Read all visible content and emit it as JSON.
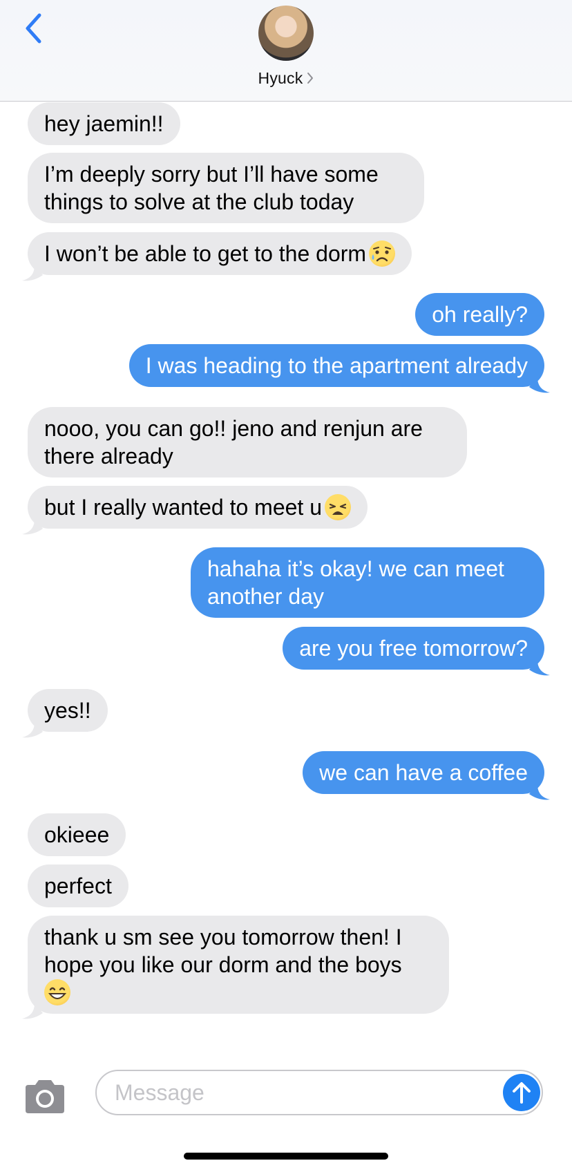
{
  "header": {
    "contact_name": "Hyuck",
    "avatar_icon": "contact-avatar-photo",
    "back_icon": "chevron-left-icon",
    "accent_color": "#2f7cf6"
  },
  "messages": [
    {
      "dir": "in",
      "text": "hey jaemin!!"
    },
    {
      "dir": "in",
      "text": "I’m deeply sorry but I’ll have some things to solve at the club today"
    },
    {
      "dir": "in",
      "text": "I won’t be able to get to the dorm",
      "emoji": "sad-relieved-face-emoji"
    },
    {
      "dir": "out",
      "text": "oh really?"
    },
    {
      "dir": "out",
      "text": "I was heading to the apartment already"
    },
    {
      "dir": "in",
      "text": "nooo, you can go!! jeno and renjun are there already"
    },
    {
      "dir": "in",
      "text": "but I really wanted to meet u",
      "emoji": "weary-face-emoji"
    },
    {
      "dir": "out",
      "text": "hahaha it’s okay! we can meet another day"
    },
    {
      "dir": "out",
      "text": "are you free tomorrow?"
    },
    {
      "dir": "in",
      "text": "yes!!"
    },
    {
      "dir": "out",
      "text": "we can have a coffee"
    },
    {
      "dir": "in",
      "text": "okieee"
    },
    {
      "dir": "in",
      "text": "perfect"
    },
    {
      "dir": "in",
      "text": "thank u sm see you tomorrow then! I hope you like our dorm and the boys",
      "emoji": "grinning-face-emoji"
    }
  ],
  "colors": {
    "incoming_bubble": "#e9e9eb",
    "outgoing_bubble": "#4794ee",
    "send_button": "#1f82f4"
  },
  "composer": {
    "placeholder": "Message",
    "camera_icon": "camera-icon",
    "send_icon": "arrow-up-icon"
  }
}
